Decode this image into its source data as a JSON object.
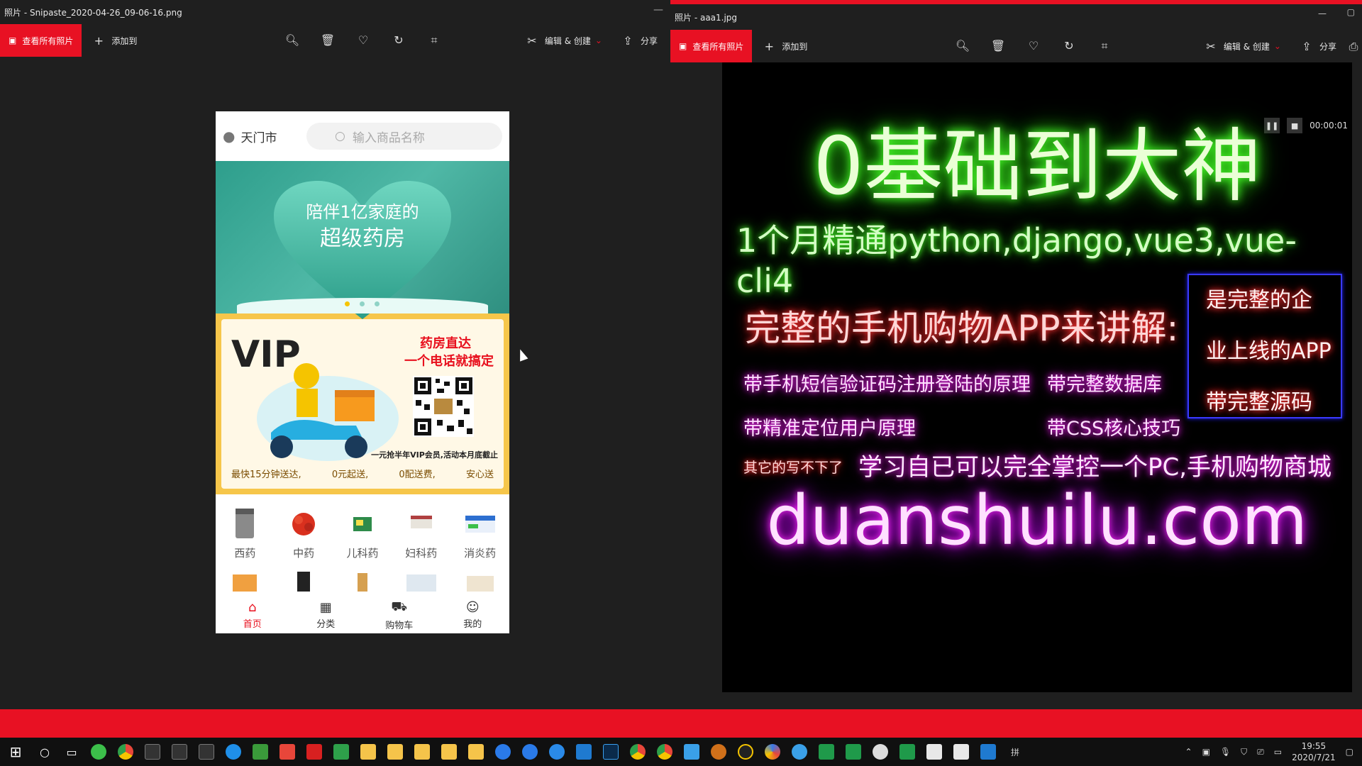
{
  "window1": {
    "title": "照片 - Snipaste_2020-04-26_09-06-16.png",
    "all_photos": "查看所有照片",
    "add_to": "添加到",
    "edit_create": "编辑 & 创建",
    "share": "分享",
    "minimize": "—"
  },
  "phone": {
    "city": "天门市",
    "search_placeholder": "输入商品名称",
    "banner_line1": "陪伴1亿家庭的",
    "banner_line2": "超级药房",
    "vip_title": "VIP",
    "vip_r1": "药房直达",
    "vip_r2": "一个电话就搞定",
    "vip_small": "一元抢半年VIP会员,活动本月底截止",
    "vip_bottom": [
      "最快15分钟送达,",
      "0元起送,",
      "0配送费,",
      "安心送"
    ],
    "categories": [
      "西药",
      "中药",
      "儿科药",
      "妇科药",
      "消炎药"
    ],
    "nav": [
      "首页",
      "分类",
      "购物车",
      "我的"
    ]
  },
  "window2": {
    "title": "照片 - aaa1.jpg",
    "all_photos": "查看所有照片",
    "add_to": "添加到",
    "edit_create": "编辑 & 创建",
    "share": "分享"
  },
  "video": {
    "time": "00:00:01",
    "title": "0基础到大神",
    "subtitle": "1个月精通python,django,vue3,vue-cli4",
    "lecture": "完整的手机购物APP来讲解:",
    "feature1": "带手机短信验证码注册登陆的原理",
    "feature2": "带完整数据库",
    "feature3": "带精准定位用户原理",
    "feature4": "带CSS核心技巧",
    "box_line1": "是完整的企",
    "box_line2": "业上线的APP",
    "box_line3": "带完整源码",
    "other": "其它的写不下了",
    "wide": "学习自已可以完全掌控一个PC,手机购物商城",
    "domain": "duanshuilu.com"
  },
  "taskbar": {
    "time": "19:55",
    "date": "2020/7/21",
    "ime": "拼"
  },
  "colors": {
    "accent": "#e81123",
    "window_bg": "#1f1f1f"
  }
}
